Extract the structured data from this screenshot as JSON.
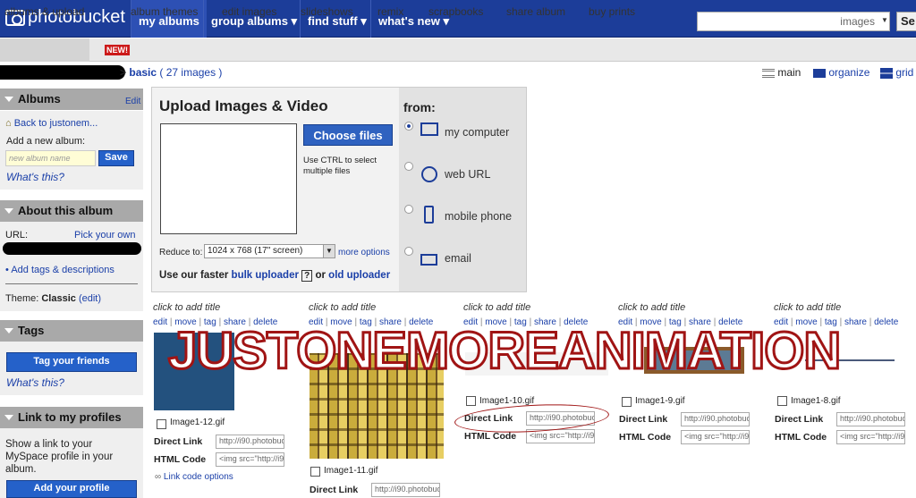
{
  "logo": {
    "text": "photobucket"
  },
  "nav": {
    "my_albums": "my albums",
    "group_albums": "group albums ▾",
    "find_stuff": "find stuff ▾",
    "whats_new": "what's new ▾"
  },
  "search": {
    "placeholder": "images",
    "button": "Se"
  },
  "subnav": {
    "albums_upload": "albums & upload",
    "new_badge": "NEW!",
    "album_themes": "album themes",
    "edit_images": "edit images",
    "slideshows": "slideshows",
    "remix": "remix",
    "scrapbooks": "scrapbooks",
    "share_album": "share album",
    "buy_prints": "buy prints"
  },
  "breadcrumb": {
    "arrow": ">",
    "current": "basic",
    "count": "( 27 images )"
  },
  "views": {
    "main": "main",
    "organize": "organize",
    "grid": "grid"
  },
  "albums": {
    "title": "Albums",
    "edit": "Edit",
    "back": "Back to justonem...",
    "add_label": "Add a new album:",
    "input_placeholder": "new album name",
    "save": "Save",
    "whats_this": "What's this?"
  },
  "about": {
    "title": "About this album",
    "url_label": "URL:",
    "pick": "Pick your own",
    "tags_link": "Add tags & descriptions",
    "theme_label": "Theme:",
    "theme_value": "Classic",
    "theme_edit": "(edit)"
  },
  "tags": {
    "title": "Tags",
    "button": "Tag your friends",
    "whats_this": "What's this?"
  },
  "profiles": {
    "title": "Link to my profiles",
    "desc": "Show a link to your MySpace profile in your album.",
    "button": "Add your profile"
  },
  "upload": {
    "title": "Upload Images & Video",
    "choose": "Choose files",
    "hint": "Use CTRL to select multiple files",
    "reduce_label": "Reduce to:",
    "reduce_value": "1024 x 768 (17\" screen)",
    "more_options": "more options",
    "faster_prefix": "Use our faster",
    "bulk": "bulk uploader",
    "q": "?",
    "or": "or",
    "old": "old uploader"
  },
  "from": {
    "title": "from:",
    "options": [
      "my computer",
      "web URL",
      "mobile phone",
      "email"
    ]
  },
  "grid": {
    "click_title": "click to add title",
    "actions": [
      "edit",
      "move",
      "tag",
      "share",
      "delete"
    ],
    "sep": " | ",
    "items": [
      {
        "name": "Image1-12.gif",
        "direct": "http://i90.photobuc",
        "html": "<img src=\"http://i9"
      },
      {
        "name": "Image1-11.gif",
        "direct": "http://i90.photobuc",
        "html": ""
      },
      {
        "name": "Image1-10.gif",
        "direct": "http://i90.photobuc",
        "html": "<img src=\"http://i9"
      },
      {
        "name": "Image1-9.gif",
        "direct": "http://i90.photobuc",
        "html": "<img src=\"http://i9"
      },
      {
        "name": "Image1-8.gif",
        "direct": "http://i90.photobuc",
        "html": "<img src=\"http://i9"
      }
    ],
    "direct_label": "Direct Link",
    "html_label": "HTML Code",
    "link_code": "Link code options"
  },
  "watermark": "JUSTONEMOREANIMATION",
  "colors": {
    "nav": "#1c3d99",
    "button": "#2561c9",
    "annotation": "#a01414"
  }
}
